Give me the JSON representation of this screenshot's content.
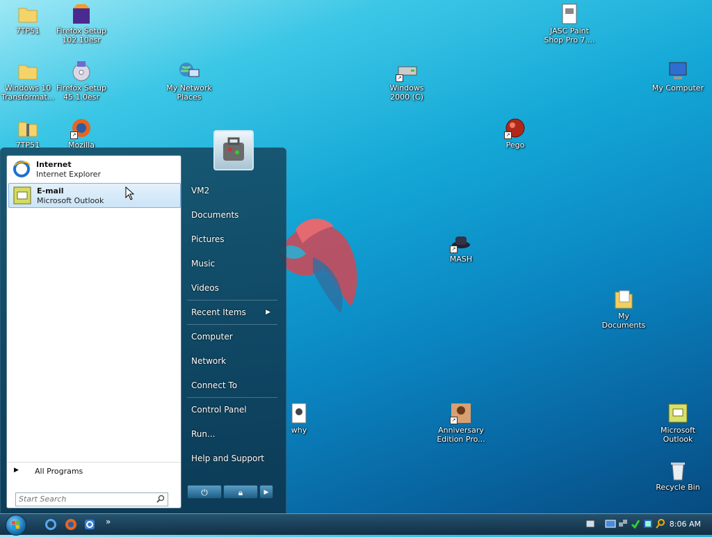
{
  "desktop": {
    "icons": [
      {
        "name": "folder-7tp51",
        "label": "7TP51"
      },
      {
        "name": "firefox-setup-102",
        "label": "Firefox Setup\n102.10esr"
      },
      {
        "name": "jasc-paint-shop",
        "label": "JASC Paint\nShop Pro 7...."
      },
      {
        "name": "folder-windows10",
        "label": "Windows 10\nTransformat..."
      },
      {
        "name": "firefox-setup-45",
        "label": "Firefox Setup\n45.1.0esr"
      },
      {
        "name": "my-network-places",
        "label": "My Network\nPlaces"
      },
      {
        "name": "windows-2000-c",
        "label": "Windows\n2000 (C)"
      },
      {
        "name": "my-computer",
        "label": "My Computer"
      },
      {
        "name": "zip-7tp51",
        "label": "7TP51"
      },
      {
        "name": "mozilla",
        "label": "Mozilla"
      },
      {
        "name": "pego",
        "label": "Pego"
      },
      {
        "name": "mash",
        "label": "MASH"
      },
      {
        "name": "my-documents",
        "label": "My\nDocuments"
      },
      {
        "name": "why",
        "label": "why"
      },
      {
        "name": "anniversary-edition",
        "label": "Anniversary\nEdition Pro..."
      },
      {
        "name": "microsoft-outlook",
        "label": "Microsoft\nOutlook"
      },
      {
        "name": "recycle-bin",
        "label": "Recycle Bin"
      }
    ]
  },
  "start_menu": {
    "pinned": [
      {
        "title": "Internet",
        "subtitle": "Internet Explorer"
      },
      {
        "title": "E-mail",
        "subtitle": "Microsoft Outlook"
      }
    ],
    "all_programs": "All Programs",
    "search_placeholder": "Start Search",
    "right_items": [
      "VM2",
      "Documents",
      "Pictures",
      "Music",
      "Videos",
      "Recent Items",
      "Computer",
      "Network",
      "Connect To",
      "Control Panel",
      "Run...",
      "Help and Support"
    ]
  },
  "taskbar": {
    "clock": "8:06 AM",
    "overflow": "»"
  },
  "colors": {
    "accent": "#1a7fb8",
    "menu_dark": "#14465f"
  }
}
